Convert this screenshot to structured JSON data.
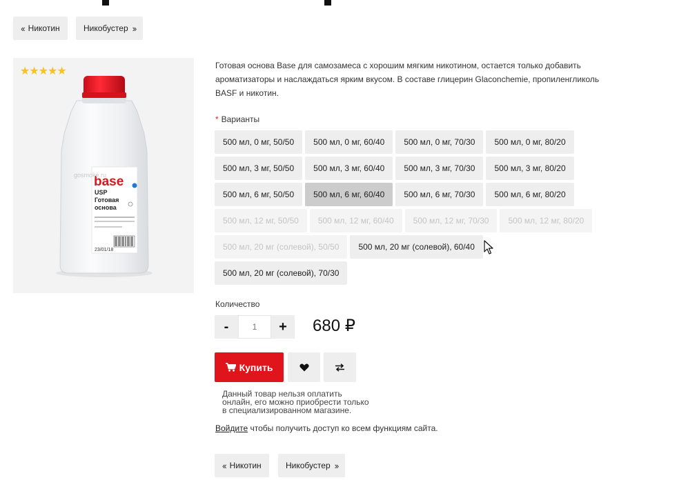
{
  "nav": {
    "prev_label": "Никотин",
    "next_label": "Никобустер"
  },
  "product": {
    "rating_stars": "★★★★★",
    "rating_value": 5,
    "image_text": {
      "brand": "base",
      "line1": "USP",
      "line2": "Готовая",
      "line3": "основа",
      "watermark": "gosmoke.ru",
      "date": "23/01/18"
    },
    "description": "Готовая основа Base для самозамеса с хорошим мягким никотином, остается только добавить ароматизаторы и наслаждаться ярким вкусом. В составе глицерин Glaconchemie, пропиленгликоль BASF и никотин."
  },
  "variants": {
    "required_mark": "*",
    "label": "Варианты",
    "rows": [
      [
        {
          "label": "500 мл, 0 мг, 50/50",
          "state": "normal"
        },
        {
          "label": "500 мл, 0 мг, 60/40",
          "state": "normal"
        },
        {
          "label": "500 мл, 0 мг, 70/30",
          "state": "normal"
        },
        {
          "label": "500 мл, 0 мг, 80/20",
          "state": "normal"
        }
      ],
      [
        {
          "label": "500 мл, 3 мг, 50/50",
          "state": "normal"
        },
        {
          "label": "500 мл, 3 мг, 60/40",
          "state": "normal"
        },
        {
          "label": "500 мл, 3 мг, 70/30",
          "state": "normal"
        },
        {
          "label": "500 мл, 3 мг, 80/20",
          "state": "normal"
        }
      ],
      [
        {
          "label": "500 мл, 6 мг, 50/50",
          "state": "normal"
        },
        {
          "label": "500 мл, 6 мг, 60/40",
          "state": "selected"
        },
        {
          "label": "500 мл, 6 мг, 70/30",
          "state": "normal"
        },
        {
          "label": "500 мл, 6 мг, 80/20",
          "state": "normal"
        }
      ],
      [
        {
          "label": "500 мл, 12 мг, 50/50",
          "state": "disabled"
        },
        {
          "label": "500 мл, 12 мг, 60/40",
          "state": "disabled"
        },
        {
          "label": "500 мл, 12 мг, 70/30",
          "state": "disabled"
        },
        {
          "label": "500 мл, 12 мг, 80/20",
          "state": "disabled"
        }
      ],
      [
        {
          "label": "500 мл, 20 мг (солевой), 50/50",
          "state": "disabled"
        },
        {
          "label": "500 мл, 20 мг (солевой), 60/40",
          "state": "normal"
        }
      ],
      [
        {
          "label": "500 мл, 20 мг (солевой), 70/30",
          "state": "normal"
        }
      ]
    ]
  },
  "quantity": {
    "label": "Количество",
    "minus": "-",
    "plus": "+",
    "value": "1"
  },
  "price": "680 ₽",
  "actions": {
    "buy_label": "Купить",
    "cart_icon": "cart-icon",
    "wishlist_icon": "heart-icon",
    "compare_icon": "compare-arrows-icon"
  },
  "notice": {
    "line1": "Данный товар нельзя оплатить",
    "line2": "онлайн, его можно приобрести только",
    "line3": "в специализированном магазине."
  },
  "login": {
    "link": "Войдите",
    "rest": " чтобы получить доступ ко всем функциям сайта."
  },
  "colors": {
    "accent": "#e0151b",
    "button_bg": "#eeeeee",
    "selected_bg": "#cccccc",
    "star": "#f5c518"
  }
}
